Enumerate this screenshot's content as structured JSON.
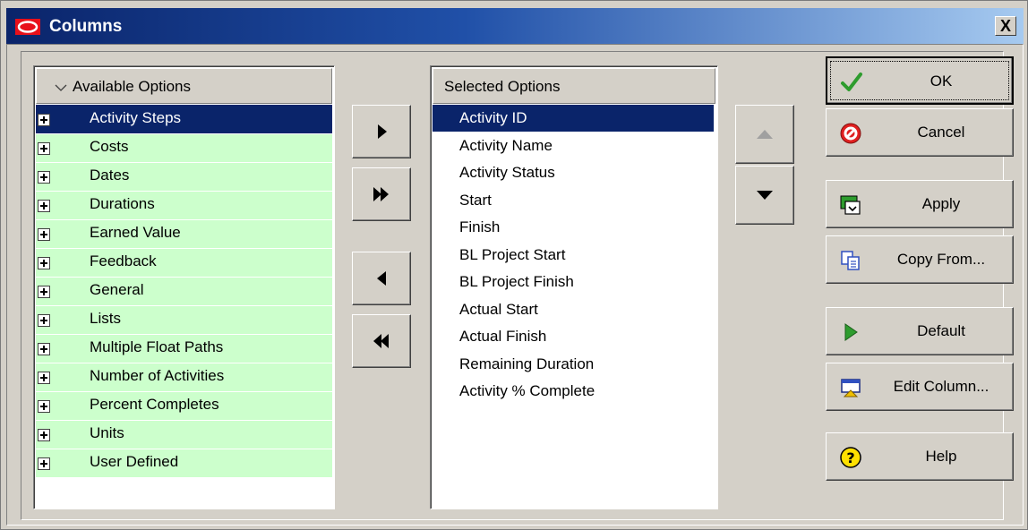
{
  "window": {
    "title": "Columns",
    "close_glyph": "X"
  },
  "available": {
    "header": "Available Options",
    "header_icon": "chevron-down-icon",
    "items": [
      {
        "label": "Activity Steps",
        "selected": true
      },
      {
        "label": "Costs"
      },
      {
        "label": "Dates"
      },
      {
        "label": "Durations"
      },
      {
        "label": "Earned Value"
      },
      {
        "label": "Feedback"
      },
      {
        "label": "General"
      },
      {
        "label": "Lists"
      },
      {
        "label": "Multiple Float Paths"
      },
      {
        "label": "Number of Activities"
      },
      {
        "label": "Percent Completes"
      },
      {
        "label": "Units"
      },
      {
        "label": "User Defined"
      }
    ],
    "row_color": "#ccffcc",
    "selected_color": "#0a246a"
  },
  "selected": {
    "header": "Selected Options",
    "items": [
      {
        "label": "Activity ID",
        "selected": true
      },
      {
        "label": "Activity Name"
      },
      {
        "label": "Activity Status"
      },
      {
        "label": "Start"
      },
      {
        "label": "Finish"
      },
      {
        "label": "BL Project Start"
      },
      {
        "label": "BL Project Finish"
      },
      {
        "label": "Actual Start"
      },
      {
        "label": "Actual Finish"
      },
      {
        "label": "Remaining Duration"
      },
      {
        "label": "Activity % Complete"
      }
    ]
  },
  "transfer_buttons": [
    {
      "name": "move-right-button",
      "icon": "triangle-right-icon"
    },
    {
      "name": "move-all-right-button",
      "icon": "double-triangle-right-icon"
    },
    {
      "name": "move-left-button",
      "icon": "triangle-left-icon"
    },
    {
      "name": "move-all-left-button",
      "icon": "double-triangle-left-icon"
    }
  ],
  "order_buttons": [
    {
      "name": "move-up-button",
      "icon": "triangle-up-icon",
      "enabled": false
    },
    {
      "name": "move-down-button",
      "icon": "triangle-down-icon",
      "enabled": true
    }
  ],
  "actions": {
    "ok": "OK",
    "cancel": "Cancel",
    "apply": "Apply",
    "copy_from": "Copy From...",
    "default": "Default",
    "edit_column": "Edit Column...",
    "help": "Help"
  }
}
